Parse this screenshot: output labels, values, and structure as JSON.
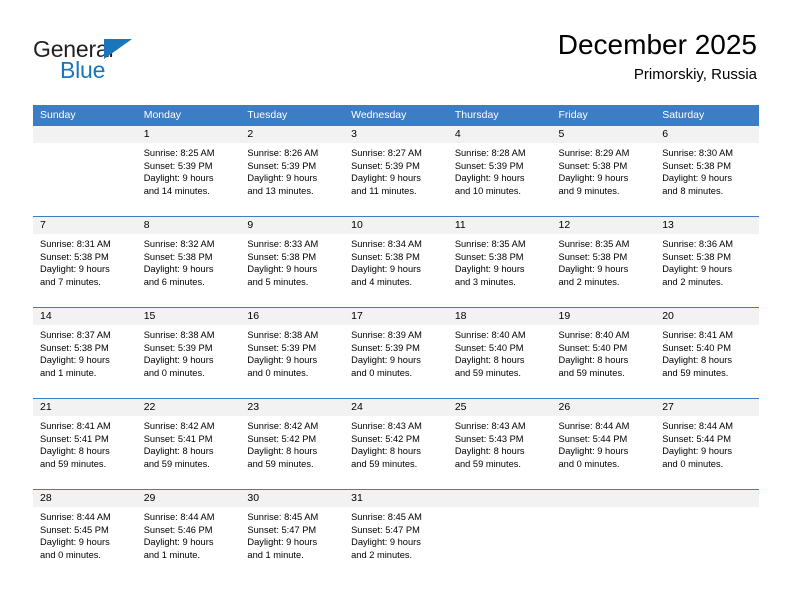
{
  "brand": {
    "name_top": "General",
    "name_bottom": "Blue",
    "accent_color": "#1b75bb",
    "triangle_icon": "triangle-icon"
  },
  "header": {
    "title": "December 2025",
    "subtitle": "Primorskiy, Russia"
  },
  "calendar": {
    "header_bg": "#3c7dc4",
    "daynum_bg": "#f2f2f2",
    "weekday_headers": [
      "Sunday",
      "Monday",
      "Tuesday",
      "Wednesday",
      "Thursday",
      "Friday",
      "Saturday"
    ],
    "weeks": [
      [
        {
          "day": "",
          "lines": []
        },
        {
          "day": "1",
          "lines": [
            "Sunrise: 8:25 AM",
            "Sunset: 5:39 PM",
            "Daylight: 9 hours",
            "and 14 minutes."
          ]
        },
        {
          "day": "2",
          "lines": [
            "Sunrise: 8:26 AM",
            "Sunset: 5:39 PM",
            "Daylight: 9 hours",
            "and 13 minutes."
          ]
        },
        {
          "day": "3",
          "lines": [
            "Sunrise: 8:27 AM",
            "Sunset: 5:39 PM",
            "Daylight: 9 hours",
            "and 11 minutes."
          ]
        },
        {
          "day": "4",
          "lines": [
            "Sunrise: 8:28 AM",
            "Sunset: 5:39 PM",
            "Daylight: 9 hours",
            "and 10 minutes."
          ]
        },
        {
          "day": "5",
          "lines": [
            "Sunrise: 8:29 AM",
            "Sunset: 5:38 PM",
            "Daylight: 9 hours",
            "and 9 minutes."
          ]
        },
        {
          "day": "6",
          "lines": [
            "Sunrise: 8:30 AM",
            "Sunset: 5:38 PM",
            "Daylight: 9 hours",
            "and 8 minutes."
          ]
        }
      ],
      [
        {
          "day": "7",
          "lines": [
            "Sunrise: 8:31 AM",
            "Sunset: 5:38 PM",
            "Daylight: 9 hours",
            "and 7 minutes."
          ]
        },
        {
          "day": "8",
          "lines": [
            "Sunrise: 8:32 AM",
            "Sunset: 5:38 PM",
            "Daylight: 9 hours",
            "and 6 minutes."
          ]
        },
        {
          "day": "9",
          "lines": [
            "Sunrise: 8:33 AM",
            "Sunset: 5:38 PM",
            "Daylight: 9 hours",
            "and 5 minutes."
          ]
        },
        {
          "day": "10",
          "lines": [
            "Sunrise: 8:34 AM",
            "Sunset: 5:38 PM",
            "Daylight: 9 hours",
            "and 4 minutes."
          ]
        },
        {
          "day": "11",
          "lines": [
            "Sunrise: 8:35 AM",
            "Sunset: 5:38 PM",
            "Daylight: 9 hours",
            "and 3 minutes."
          ]
        },
        {
          "day": "12",
          "lines": [
            "Sunrise: 8:35 AM",
            "Sunset: 5:38 PM",
            "Daylight: 9 hours",
            "and 2 minutes."
          ]
        },
        {
          "day": "13",
          "lines": [
            "Sunrise: 8:36 AM",
            "Sunset: 5:38 PM",
            "Daylight: 9 hours",
            "and 2 minutes."
          ]
        }
      ],
      [
        {
          "day": "14",
          "lines": [
            "Sunrise: 8:37 AM",
            "Sunset: 5:38 PM",
            "Daylight: 9 hours",
            "and 1 minute."
          ]
        },
        {
          "day": "15",
          "lines": [
            "Sunrise: 8:38 AM",
            "Sunset: 5:39 PM",
            "Daylight: 9 hours",
            "and 0 minutes."
          ]
        },
        {
          "day": "16",
          "lines": [
            "Sunrise: 8:38 AM",
            "Sunset: 5:39 PM",
            "Daylight: 9 hours",
            "and 0 minutes."
          ]
        },
        {
          "day": "17",
          "lines": [
            "Sunrise: 8:39 AM",
            "Sunset: 5:39 PM",
            "Daylight: 9 hours",
            "and 0 minutes."
          ]
        },
        {
          "day": "18",
          "lines": [
            "Sunrise: 8:40 AM",
            "Sunset: 5:40 PM",
            "Daylight: 8 hours",
            "and 59 minutes."
          ]
        },
        {
          "day": "19",
          "lines": [
            "Sunrise: 8:40 AM",
            "Sunset: 5:40 PM",
            "Daylight: 8 hours",
            "and 59 minutes."
          ]
        },
        {
          "day": "20",
          "lines": [
            "Sunrise: 8:41 AM",
            "Sunset: 5:40 PM",
            "Daylight: 8 hours",
            "and 59 minutes."
          ]
        }
      ],
      [
        {
          "day": "21",
          "lines": [
            "Sunrise: 8:41 AM",
            "Sunset: 5:41 PM",
            "Daylight: 8 hours",
            "and 59 minutes."
          ]
        },
        {
          "day": "22",
          "lines": [
            "Sunrise: 8:42 AM",
            "Sunset: 5:41 PM",
            "Daylight: 8 hours",
            "and 59 minutes."
          ]
        },
        {
          "day": "23",
          "lines": [
            "Sunrise: 8:42 AM",
            "Sunset: 5:42 PM",
            "Daylight: 8 hours",
            "and 59 minutes."
          ]
        },
        {
          "day": "24",
          "lines": [
            "Sunrise: 8:43 AM",
            "Sunset: 5:42 PM",
            "Daylight: 8 hours",
            "and 59 minutes."
          ]
        },
        {
          "day": "25",
          "lines": [
            "Sunrise: 8:43 AM",
            "Sunset: 5:43 PM",
            "Daylight: 8 hours",
            "and 59 minutes."
          ]
        },
        {
          "day": "26",
          "lines": [
            "Sunrise: 8:44 AM",
            "Sunset: 5:44 PM",
            "Daylight: 9 hours",
            "and 0 minutes."
          ]
        },
        {
          "day": "27",
          "lines": [
            "Sunrise: 8:44 AM",
            "Sunset: 5:44 PM",
            "Daylight: 9 hours",
            "and 0 minutes."
          ]
        }
      ],
      [
        {
          "day": "28",
          "lines": [
            "Sunrise: 8:44 AM",
            "Sunset: 5:45 PM",
            "Daylight: 9 hours",
            "and 0 minutes."
          ]
        },
        {
          "day": "29",
          "lines": [
            "Sunrise: 8:44 AM",
            "Sunset: 5:46 PM",
            "Daylight: 9 hours",
            "and 1 minute."
          ]
        },
        {
          "day": "30",
          "lines": [
            "Sunrise: 8:45 AM",
            "Sunset: 5:47 PM",
            "Daylight: 9 hours",
            "and 1 minute."
          ]
        },
        {
          "day": "31",
          "lines": [
            "Sunrise: 8:45 AM",
            "Sunset: 5:47 PM",
            "Daylight: 9 hours",
            "and 2 minutes."
          ]
        },
        {
          "day": "",
          "lines": []
        },
        {
          "day": "",
          "lines": []
        },
        {
          "day": "",
          "lines": []
        }
      ]
    ]
  }
}
